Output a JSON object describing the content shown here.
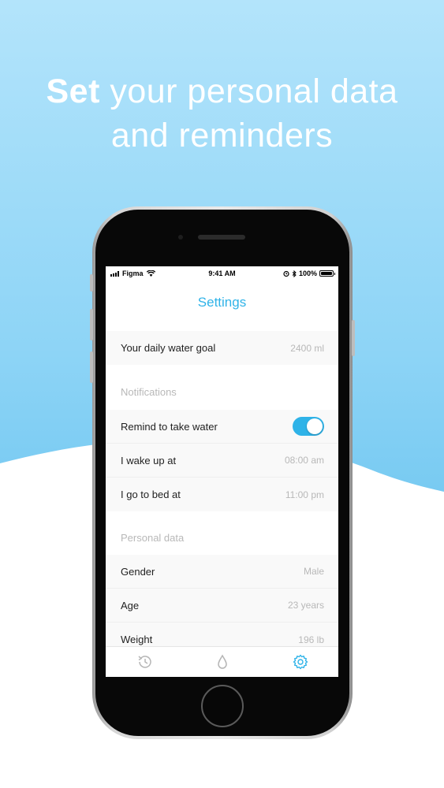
{
  "headline": {
    "strong": "Set",
    "rest": " your personal data",
    "line2": "and reminders"
  },
  "status_bar": {
    "carrier": "Figma",
    "time": "9:41 AM",
    "battery": "100%"
  },
  "screen": {
    "title": "Settings"
  },
  "daily_goal": {
    "label": "Your daily water goal",
    "value": "2400 ml"
  },
  "notifications": {
    "header": "Notifications",
    "remind": {
      "label": "Remind to take water",
      "enabled": true
    },
    "wake": {
      "label": "I wake up at",
      "value": "08:00 am"
    },
    "bed": {
      "label": "I go to bed at",
      "value": "11:00 pm"
    }
  },
  "personal": {
    "header": "Personal data",
    "gender": {
      "label": "Gender",
      "value": "Male"
    },
    "age": {
      "label": "Age",
      "value": "23 years"
    },
    "weight": {
      "label": "Weight",
      "value": "196 lb"
    }
  },
  "tabs": [
    {
      "icon": "history-icon",
      "active": false
    },
    {
      "icon": "water-drop-icon",
      "active": false
    },
    {
      "icon": "settings-gear-icon",
      "active": true
    }
  ],
  "colors": {
    "accent": "#2fb3e8",
    "background_top": "#b3e4fb",
    "background_bottom": "#6fc6f0"
  }
}
